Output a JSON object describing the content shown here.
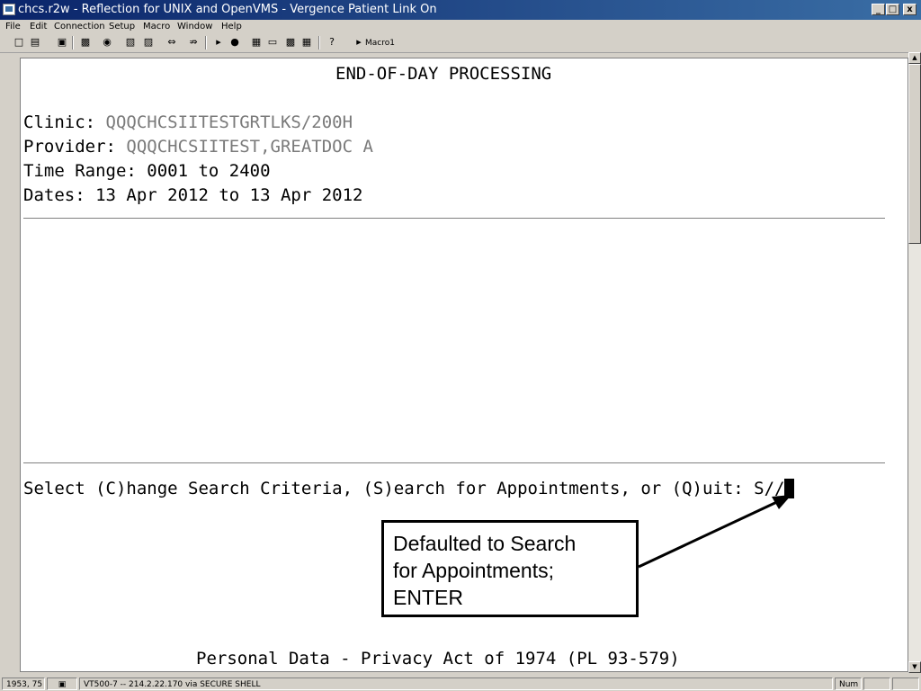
{
  "window": {
    "title": "chcs.r2w - Reflection for UNIX and OpenVMS - Vergence Patient Link On",
    "minimize_label": "_",
    "restore_label": "□",
    "close_label": "x"
  },
  "menu": {
    "items": [
      "File",
      "Edit",
      "Connection",
      "Setup",
      "Macro",
      "Window",
      "Help"
    ]
  },
  "toolbar": {
    "icons": [
      "new-document-icon",
      "open-folder-icon",
      "save-icon",
      "print-icon",
      "find-icon",
      "copy-icon",
      "paste-icon",
      "connect-icon",
      "disconnect-icon",
      "play-icon",
      "record-icon",
      "settings-icon",
      "chat-icon",
      "transfer-icon",
      "grid-icon",
      "help-icon",
      "macro-run-icon"
    ],
    "macro_label": "Macro1"
  },
  "terminal": {
    "heading": "END-OF-DAY PROCESSING",
    "clinic_label": "Clinic: ",
    "clinic_value": "QQQCHCSIITESTGRTLKS/200H",
    "provider_label": "Provider: ",
    "provider_value": "QQQCHCSIITEST,GREATDOC A",
    "time_range": "Time Range: 0001 to 2400",
    "dates": "Dates: 13 Apr 2012 to 13 Apr 2012",
    "prompt": "Select (C)hange Search Criteria, (S)earch for Appointments, or (Q)uit: S//",
    "footer": "Personal Data - Privacy Act of 1974 (PL 93-579)"
  },
  "callout": {
    "text": "Defaulted to Search\nfor Appointments;\nENTER"
  },
  "status": {
    "position": "1953, 75",
    "connection": "VT500-7 -- 214.2.22.170 via SECURE SHELL",
    "num": "Num"
  }
}
